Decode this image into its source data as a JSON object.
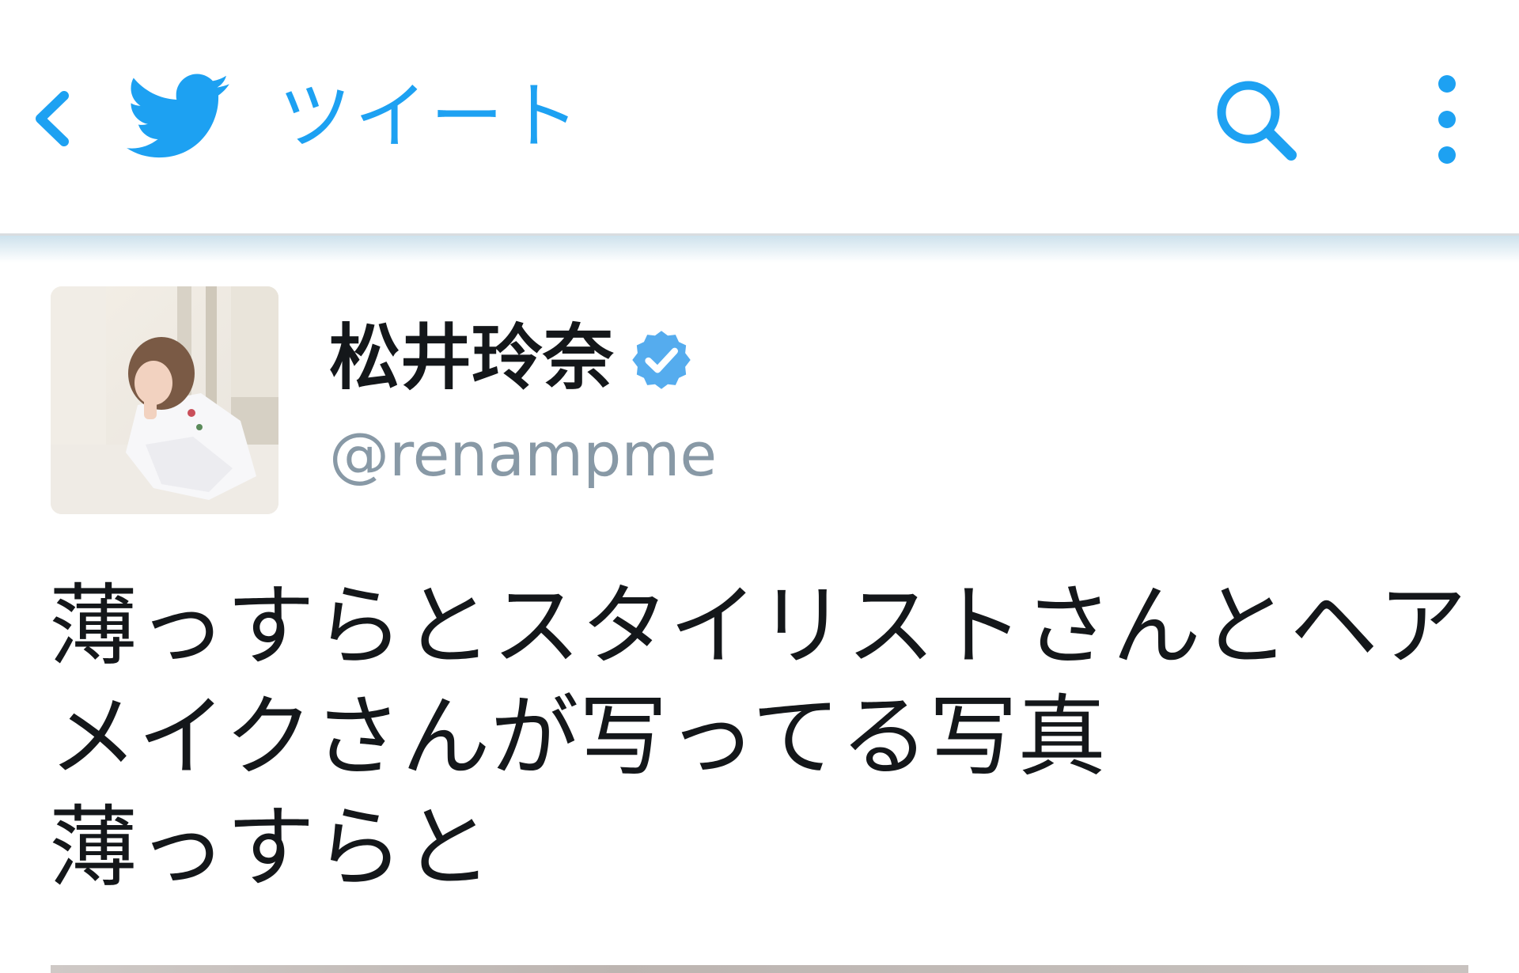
{
  "header": {
    "title": "ツイート",
    "back_icon": "chevron-left-icon",
    "logo_icon": "twitter-bird-icon",
    "search_icon": "search-icon",
    "more_icon": "more-vertical-icon"
  },
  "tweet": {
    "author": {
      "display_name": "松井玲奈",
      "handle": "@renampme",
      "verified": true,
      "avatar": "avatar-photo"
    },
    "text_lines": [
      "薄っすらとスタイリストさんとヘア",
      "メイクさんが写ってる写真",
      "薄っすらと"
    ],
    "media": "attached-photo"
  },
  "colors": {
    "accent": "#1da1f2",
    "text_primary": "#14171a",
    "text_secondary": "#8899a6",
    "verified_badge": "#55acee",
    "divider": "#d9dde0"
  }
}
